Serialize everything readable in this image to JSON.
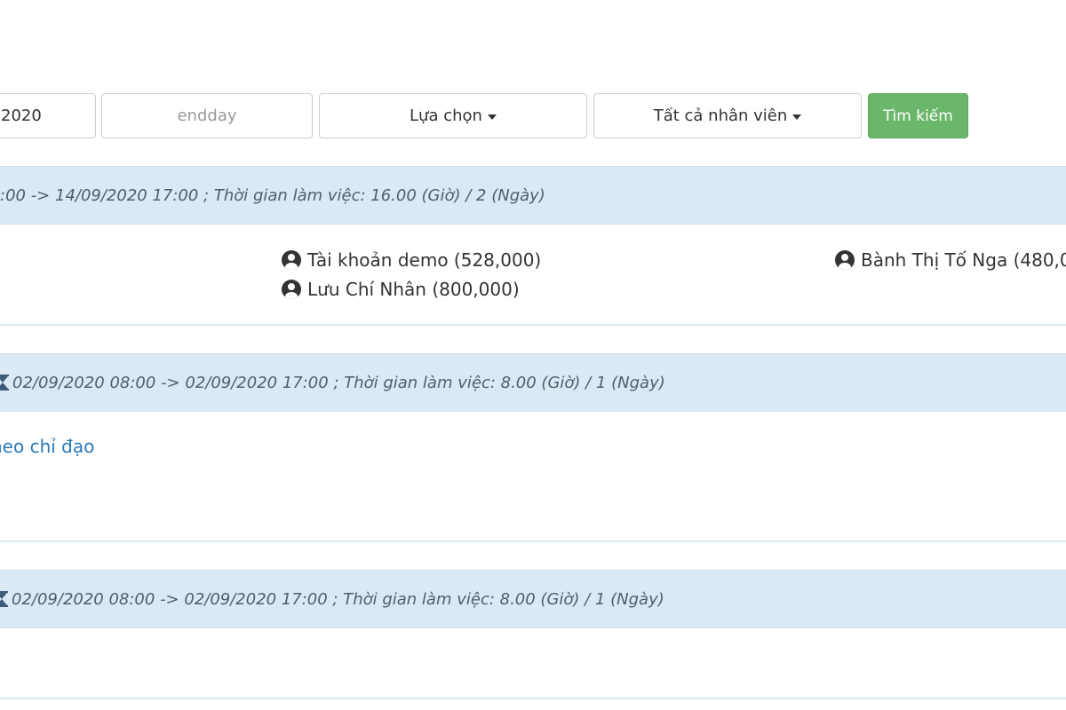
{
  "filters": {
    "start_date": "2020",
    "end_placeholder": "endday",
    "select_option": "Lựa chọn",
    "select_staff": "Tất cả nhân viên",
    "search_label": "Tìm kiếm"
  },
  "rows": [
    {
      "time_text": ":00 -> 14/09/2020 17:00 ; Thời gian làm việc: 16.00 (Giờ) / 2 (Ngày)",
      "people": [
        "Tài khoản demo (528,000)",
        "Lưu Chí Nhân (800,000)",
        "Bành Thị Tố Nga (480,00"
      ]
    },
    {
      "time_text": "02/09/2020 08:00 -> 02/09/2020 17:00 ; Thời gian làm việc: 8.00 (Giờ) / 1 (Ngày)",
      "link_text": "heo chỉ đạo"
    },
    {
      "time_text": "02/09/2020 08:00 -> 02/09/2020 17:00 ; Thời gian làm việc: 8.00 (Giờ) / 1 (Ngày)"
    }
  ]
}
